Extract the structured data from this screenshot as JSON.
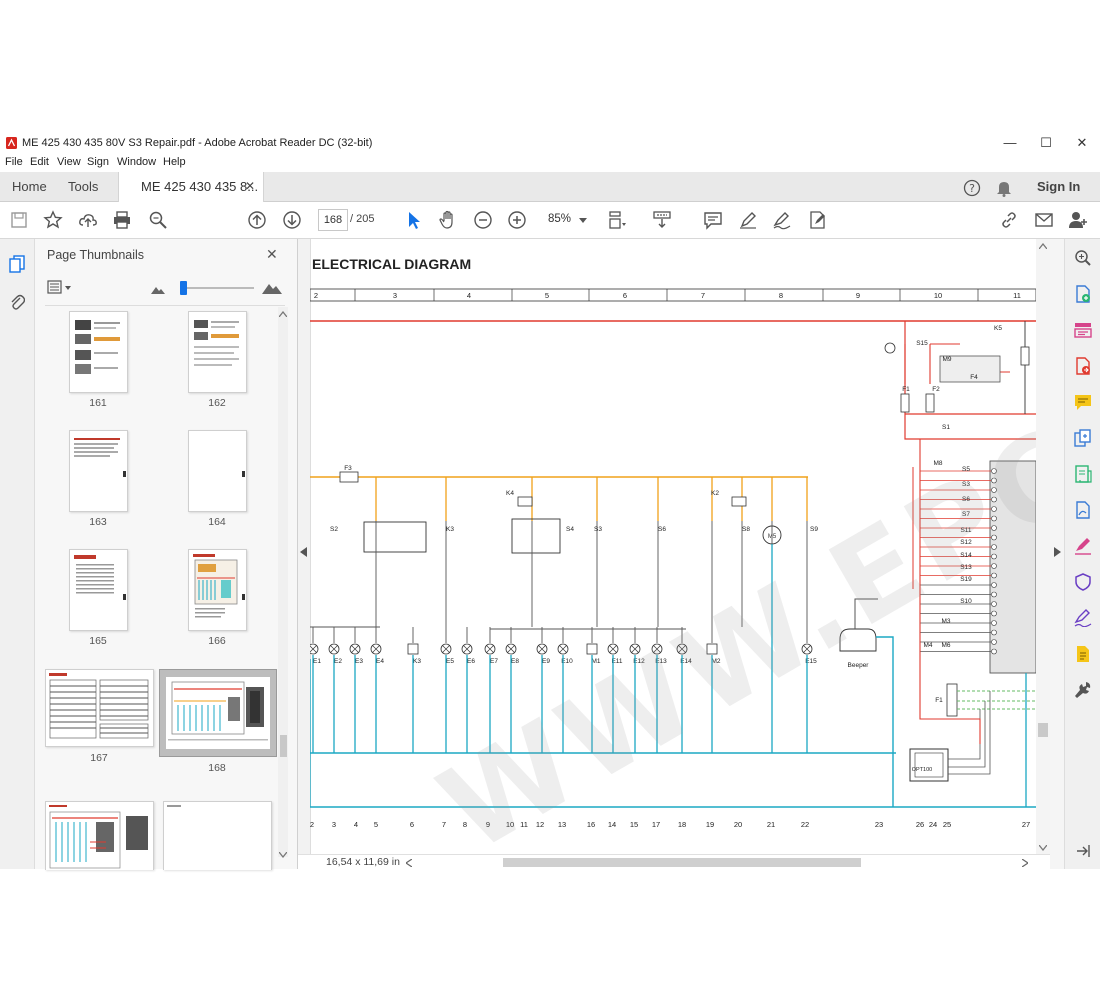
{
  "window": {
    "title": "ME 425 430 435 80V S3 Repair.pdf - Adobe Acrobat Reader DC (32-bit)",
    "minimize": "—",
    "maximize": "☐",
    "close": "✕"
  },
  "menu": [
    "File",
    "Edit",
    "View",
    "Sign",
    "Window",
    "Help"
  ],
  "tabs": {
    "home": "Home",
    "tools": "Tools",
    "document": "ME 425 430 435 8...",
    "close": "✕",
    "sign_in": "Sign In"
  },
  "toolbar": {
    "page_current": "168",
    "page_total": "/ 205",
    "zoom": "85%"
  },
  "thumbnails": {
    "title": "Page Thumbnails",
    "close": "✕",
    "pages": [
      "161",
      "162",
      "163",
      "164",
      "165",
      "166",
      "167",
      "168"
    ]
  },
  "document": {
    "heading": "ELECTRICAL DIAGRAM",
    "top_columns": [
      "2",
      "3",
      "4",
      "5",
      "6",
      "7",
      "8",
      "9",
      "10",
      "11"
    ],
    "bottom_numbers": [
      "2",
      "3",
      "4",
      "5",
      "6",
      "7",
      "8",
      "9",
      "10",
      "11",
      "12",
      "13",
      "16",
      "14",
      "15",
      "17",
      "18",
      "19",
      "20",
      "21",
      "22",
      "23",
      "26",
      "24",
      "25",
      "27"
    ],
    "lamp_labels": [
      "E1",
      "E2",
      "E3",
      "E4",
      "K3",
      "E5",
      "E6",
      "E7",
      "E8",
      "E9",
      "E10",
      "M1",
      "E11",
      "E12",
      "E13",
      "E14",
      "M2",
      "E15"
    ],
    "switch_labels": [
      "S2",
      "K3",
      "K4",
      "S4",
      "S3",
      "S6",
      "K2",
      "S8",
      "M5",
      "S9"
    ],
    "fuse_label": "F3",
    "right_labels": [
      "K5",
      "S15",
      "M9",
      "F4",
      "F1",
      "F2",
      "S1",
      "M8",
      "S5",
      "S3",
      "S6",
      "S7",
      "S11",
      "S12",
      "S14",
      "S13",
      "S19",
      "S10",
      "M3",
      "M4",
      "M6",
      "F1",
      "OPT100",
      "Beeper"
    ],
    "watermark": "WWW.EPCDEPO.COM"
  },
  "status": {
    "page_size": "16,54 x 11,69 in"
  },
  "colors": {
    "red_wire": "#e03a2f",
    "orange_wire": "#f0a21a",
    "cyan_wire": "#1ba8c4",
    "grey_wire": "#555555",
    "accent": "#1473e6"
  }
}
